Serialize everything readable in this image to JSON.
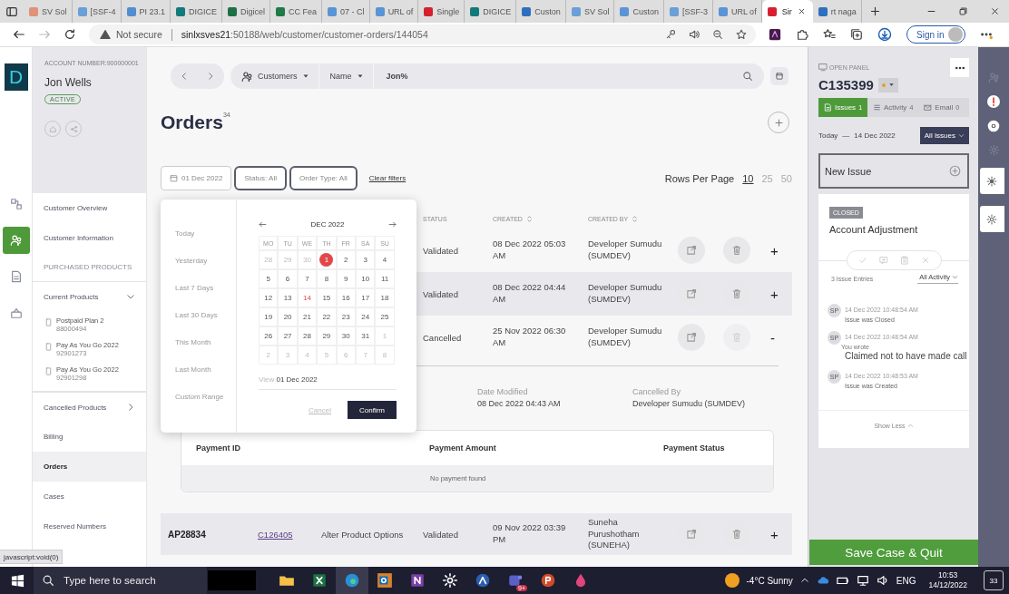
{
  "browser": {
    "tabs": [
      {
        "title": "SV Sol",
        "color": "#e0917a",
        "selected": false
      },
      {
        "title": "[SSF-4",
        "color": "#6a9fd8",
        "selected": false
      },
      {
        "title": "PI 23.1",
        "color": "#4f8fd0",
        "selected": false
      },
      {
        "title": "DIGICE",
        "color": "#127a7a",
        "selected": false
      },
      {
        "title": "Digicel",
        "color": "#1d7044",
        "selected": false
      },
      {
        "title": "CC Fea",
        "color": "#1f7a45",
        "selected": false
      },
      {
        "title": "07 - Cl",
        "color": "#5a94d6",
        "selected": false
      },
      {
        "title": "URL of",
        "color": "#5a94d6",
        "selected": false
      },
      {
        "title": "Single",
        "color": "#d6202f",
        "selected": false
      },
      {
        "title": "DIGICE",
        "color": "#127a7a",
        "selected": false
      },
      {
        "title": "Custon",
        "color": "#2f6fc0",
        "selected": false
      },
      {
        "title": "SV Sol",
        "color": "#6a9fd8",
        "selected": false
      },
      {
        "title": "Custon",
        "color": "#5a94d6",
        "selected": false
      },
      {
        "title": "[SSF-3",
        "color": "#6a9fd8",
        "selected": false
      },
      {
        "title": "URL of",
        "color": "#5a94d6",
        "selected": false
      },
      {
        "title": "Sir",
        "color": "#d6202f",
        "selected": true
      },
      {
        "title": "rt naga",
        "color": "#2f6fc0",
        "selected": false
      }
    ],
    "security": "Not secure",
    "url_host": "sinlxsves21",
    "url_path": ":50188/web/customer/customer-orders/144054",
    "sign_in": "Sign in"
  },
  "rail": {
    "logo": "D",
    "items": [
      {
        "kind": "diagram",
        "selected": false
      },
      {
        "kind": "people",
        "selected": true
      },
      {
        "kind": "document",
        "selected": false
      },
      {
        "kind": "basket",
        "selected": false
      }
    ]
  },
  "customer": {
    "account_number": "ACCOUNT NUMBER:900000001",
    "name": "Jon Wells",
    "status": "ACTIVE"
  },
  "nav": [
    {
      "kind": "link",
      "label": "Customer Overview",
      "selected": false
    },
    {
      "kind": "link",
      "label": "Customer Information",
      "selected": false
    },
    {
      "kind": "header",
      "label": "PURCHASED PRODUCTS",
      "selected": false
    },
    {
      "kind": "group",
      "label": "Current Products",
      "selected": false,
      "expanded": true,
      "children": [
        {
          "label": "Postpaid Plan 2",
          "number": "88000494"
        },
        {
          "label": "Pay As You Go 2022",
          "number": "92901273"
        },
        {
          "label": "Pay As You Go 2022",
          "number": "92901298"
        }
      ]
    },
    {
      "kind": "group",
      "label": "Cancelled Products",
      "selected": false,
      "expanded": false
    },
    {
      "kind": "link",
      "label": "Billing",
      "selected": false
    },
    {
      "kind": "link",
      "label": "Orders",
      "selected": true
    },
    {
      "kind": "link",
      "label": "Cases",
      "selected": false
    },
    {
      "kind": "link",
      "label": "Reserved Numbers",
      "selected": false
    }
  ],
  "search": {
    "scope": "Customers",
    "field": "Name",
    "value": "Jon%"
  },
  "page": {
    "title": "Orders",
    "count": "34"
  },
  "filters": {
    "date": "01 Dec 2022",
    "status": "Status: All",
    "order_type": "Order Type: All",
    "clear": "Clear filters"
  },
  "rows_per_page": {
    "label": "Rows Per Page",
    "options": [
      {
        "label": "10",
        "selected": true
      },
      {
        "label": "25",
        "selected": false
      },
      {
        "label": "50",
        "selected": false
      }
    ]
  },
  "table": {
    "columns": [
      {
        "label": "STATUS",
        "sortable": false
      },
      {
        "label": "CREATED",
        "sortable": true
      },
      {
        "label": "CREATED BY",
        "sortable": true
      }
    ],
    "rows": [
      {
        "status": "Validated",
        "created": "08 Dec 2022 05:03 AM",
        "created_by": "Developer Sumudu (SUMDEV)",
        "delete_disabled": false,
        "highlighted": false,
        "toggle": "+"
      },
      {
        "status": "Validated",
        "created": "08 Dec 2022 04:44 AM",
        "created_by": "Developer Sumudu (SUMDEV)",
        "delete_disabled": false,
        "highlighted": true,
        "toggle": "+"
      },
      {
        "status": "Cancelled",
        "created": "25 Nov 2022 06:30 AM",
        "created_by": "Developer Sumudu (SUMDEV)",
        "delete_disabled": true,
        "highlighted": false,
        "toggle": "-",
        "details": [
          {
            "label": "Date Modified",
            "value": "08 Dec 2022 04:43 AM"
          },
          {
            "label": "Cancelled By",
            "value": "Developer Sumudu (SUMDEV)"
          }
        ],
        "payments": {
          "columns": [
            "Payment ID",
            "Payment Amount",
            "Payment Status"
          ],
          "empty": "No payment found"
        }
      },
      {
        "order_id": "AP28834",
        "case": "C126405",
        "type": "Alter Product Options",
        "status": "Validated",
        "created": "09 Nov 2022 03:39 PM",
        "created_by": "Suneha Purushotham (SUNEHA)",
        "delete_disabled": false,
        "highlighted": true,
        "toggle": "+"
      }
    ]
  },
  "date_picker": {
    "presets": [
      "Today",
      "Yesterday",
      "Last 7 Days",
      "Last 30 Days",
      "This Month",
      "Last Month",
      "Custom Range"
    ],
    "month": "DEC  2022",
    "weekdays": [
      "MO",
      "TU",
      "WE",
      "TH",
      "FR",
      "SA",
      "SU"
    ],
    "weeks": [
      [
        {
          "d": "28",
          "in_month": false,
          "selected": false,
          "today": false
        },
        {
          "d": "29",
          "in_month": false,
          "selected": false,
          "today": false
        },
        {
          "d": "30",
          "in_month": false,
          "selected": false,
          "today": false
        },
        {
          "d": "1",
          "in_month": true,
          "selected": true,
          "today": false
        },
        {
          "d": "2",
          "in_month": true,
          "selected": false,
          "today": false
        },
        {
          "d": "3",
          "in_month": true,
          "selected": false,
          "today": false
        },
        {
          "d": "4",
          "in_month": true,
          "selected": false,
          "today": false
        }
      ],
      [
        {
          "d": "5",
          "in_month": true,
          "selected": false,
          "today": false
        },
        {
          "d": "6",
          "in_month": true,
          "selected": false,
          "today": false
        },
        {
          "d": "7",
          "in_month": true,
          "selected": false,
          "today": false
        },
        {
          "d": "8",
          "in_month": true,
          "selected": false,
          "today": false
        },
        {
          "d": "9",
          "in_month": true,
          "selected": false,
          "today": false
        },
        {
          "d": "10",
          "in_month": true,
          "selected": false,
          "today": false
        },
        {
          "d": "11",
          "in_month": true,
          "selected": false,
          "today": false
        }
      ],
      [
        {
          "d": "12",
          "in_month": true,
          "selected": false,
          "today": false
        },
        {
          "d": "13",
          "in_month": true,
          "selected": false,
          "today": false
        },
        {
          "d": "14",
          "in_month": true,
          "selected": false,
          "today": true
        },
        {
          "d": "15",
          "in_month": true,
          "selected": false,
          "today": false
        },
        {
          "d": "16",
          "in_month": true,
          "selected": false,
          "today": false
        },
        {
          "d": "17",
          "in_month": true,
          "selected": false,
          "today": false
        },
        {
          "d": "18",
          "in_month": true,
          "selected": false,
          "today": false
        }
      ],
      [
        {
          "d": "19",
          "in_month": true,
          "selected": false,
          "today": false
        },
        {
          "d": "20",
          "in_month": true,
          "selected": false,
          "today": false
        },
        {
          "d": "21",
          "in_month": true,
          "selected": false,
          "today": false
        },
        {
          "d": "22",
          "in_month": true,
          "selected": false,
          "today": false
        },
        {
          "d": "23",
          "in_month": true,
          "selected": false,
          "today": false
        },
        {
          "d": "24",
          "in_month": true,
          "selected": false,
          "today": false
        },
        {
          "d": "25",
          "in_month": true,
          "selected": false,
          "today": false
        }
      ],
      [
        {
          "d": "26",
          "in_month": true,
          "selected": false,
          "today": false
        },
        {
          "d": "27",
          "in_month": true,
          "selected": false,
          "today": false
        },
        {
          "d": "28",
          "in_month": true,
          "selected": false,
          "today": false
        },
        {
          "d": "29",
          "in_month": true,
          "selected": false,
          "today": false
        },
        {
          "d": "30",
          "in_month": true,
          "selected": false,
          "today": false
        },
        {
          "d": "31",
          "in_month": true,
          "selected": false,
          "today": false
        },
        {
          "d": "1",
          "in_month": false,
          "selected": false,
          "today": false
        }
      ],
      [
        {
          "d": "2",
          "in_month": false,
          "selected": false,
          "today": false
        },
        {
          "d": "3",
          "in_month": false,
          "selected": false,
          "today": false
        },
        {
          "d": "4",
          "in_month": false,
          "selected": false,
          "today": false
        },
        {
          "d": "5",
          "in_month": false,
          "selected": false,
          "today": false
        },
        {
          "d": "6",
          "in_month": false,
          "selected": false,
          "today": false
        },
        {
          "d": "7",
          "in_month": false,
          "selected": false,
          "today": false
        },
        {
          "d": "8",
          "in_month": false,
          "selected": false,
          "today": false
        }
      ]
    ],
    "view_label": "View",
    "view_date": "01 Dec 2022",
    "cancel": "Cancel",
    "confirm": "Confirm"
  },
  "case_panel": {
    "open_panel": "OPEN PANEL",
    "case_id": "C135399",
    "tabs": [
      {
        "label": "Issues",
        "count": "1",
        "selected": true
      },
      {
        "label": "Activity",
        "count": "4",
        "selected": false
      },
      {
        "label": "Email",
        "count": "0",
        "selected": false
      }
    ],
    "date_label": "Today",
    "date_sep": "—",
    "date": "14 Dec 2022",
    "filter": "All Issues",
    "new_issue": "New Issue",
    "issue": {
      "status": "CLOSED",
      "title": "Account Adjustment",
      "entries_count": "3 Issue Entries",
      "activity_filter": "All Activity",
      "entries": [
        {
          "kind": "event",
          "avatar": "SP",
          "time": "14 Dec 2022 10:48:54 AM",
          "text": "Issue was Closed"
        },
        {
          "kind": "note",
          "avatar": "SP",
          "time": "14 Dec 2022 10:48:54 AM",
          "author": "You wrote",
          "text": "Claimed not to have made call"
        },
        {
          "kind": "event",
          "avatar": "SP",
          "time": "14 Dec 2022 10:48:53 AM",
          "text": "Issue was Created"
        }
      ],
      "show_less": "Show Less"
    },
    "save": "Save Case & Quit"
  },
  "status_link": "javascript:void(0)",
  "taskbar": {
    "search_placeholder": "Type here to search",
    "apps": [
      {
        "kind": "folder",
        "selected": false
      },
      {
        "kind": "excel",
        "selected": false
      },
      {
        "kind": "edge",
        "selected": true
      },
      {
        "kind": "outlook",
        "selected": false
      },
      {
        "kind": "onenote",
        "selected": false
      },
      {
        "kind": "settings",
        "selected": false
      },
      {
        "kind": "triangle",
        "selected": false
      },
      {
        "kind": "teams",
        "selected": false,
        "badge": "9+"
      },
      {
        "kind": "powerpoint",
        "selected": false
      },
      {
        "kind": "drop",
        "selected": false
      }
    ],
    "weather": "-4°C Sunny",
    "lang": "ENG",
    "time": "10:53",
    "date": "14/12/2022",
    "notifications": "33"
  }
}
